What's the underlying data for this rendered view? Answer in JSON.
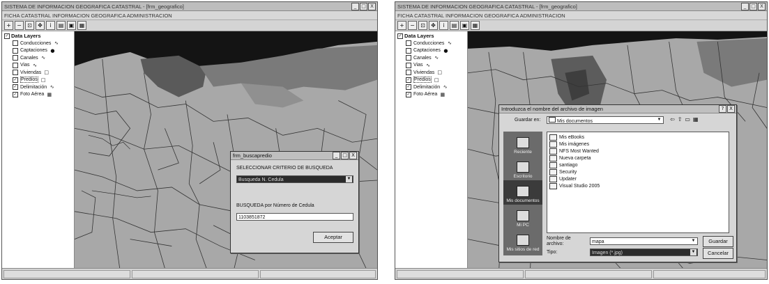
{
  "left": {
    "title": "SISTEMA DE INFORMACION GEOGRAFICA CATASTRAL - [frm_geografico]",
    "menu": "FICHA CATASTRAL   INFORMACION GEOGRAFICA   ADMINISTRACION",
    "window_buttons": [
      "_",
      "□",
      "X"
    ],
    "layers_title": "Data Layers",
    "layers": [
      {
        "label": "Conducciones",
        "checked": false,
        "symbol": "∿"
      },
      {
        "label": "Captaciones",
        "checked": false,
        "symbol": "●"
      },
      {
        "label": "Canales",
        "checked": false,
        "symbol": "∿"
      },
      {
        "label": "Vias",
        "checked": false,
        "symbol": "∿"
      },
      {
        "label": "Viviendas",
        "checked": false,
        "symbol": "□"
      },
      {
        "label": "Predios",
        "checked": true,
        "symbol": "□"
      },
      {
        "label": "Delimitación",
        "checked": true,
        "symbol": "∿"
      },
      {
        "label": "Foto Aérea",
        "checked": true,
        "symbol": "▦"
      }
    ],
    "dialog": {
      "title": "frm_buscapredio",
      "buttons": [
        "_",
        "□",
        "X"
      ],
      "criteria_label": "SELECCIONAR CRITERIO DE BUSQUEDA",
      "criteria_value": "Busqueda N. Cedula",
      "search_label": "BUSQUEDA por Número de Cedula",
      "search_value": "1103851872",
      "accept": "Aceptar"
    }
  },
  "right": {
    "title": "SISTEMA DE INFORMACION GEOGRAFICA CATASTRAL - [frm_geografico]",
    "menu": "FICHA CATASTRAL   INFORMACION GEOGRAFICA   ADMINISTRACION",
    "window_buttons": [
      "_",
      "□",
      "X"
    ],
    "layers_title": "Data Layers",
    "layers": [
      {
        "label": "Conducciones",
        "checked": false,
        "symbol": "∿"
      },
      {
        "label": "Captaciones",
        "checked": false,
        "symbol": "●"
      },
      {
        "label": "Canales",
        "checked": false,
        "symbol": "∿"
      },
      {
        "label": "Vias",
        "checked": false,
        "symbol": "∿"
      },
      {
        "label": "Viviendas",
        "checked": false,
        "symbol": "□"
      },
      {
        "label": "Predios",
        "checked": true,
        "symbol": "□"
      },
      {
        "label": "Delimitación",
        "checked": true,
        "symbol": "∿"
      },
      {
        "label": "Foto Aérea",
        "checked": true,
        "symbol": "▦"
      }
    ],
    "dialog": {
      "title": "Introduzca el nombre del archivo de imagen",
      "buttons": [
        "?",
        "X"
      ],
      "save_in_label": "Guardar en:",
      "save_in_value": "Mis documentos",
      "places": [
        "Reciente",
        "Escritorio",
        "Mis documentos",
        "Mi PC",
        "Mis sitios de red"
      ],
      "files": [
        "Mis eBooks",
        "Mis imágenes",
        "NFS Most Wanted",
        "Nueva carpeta",
        "santiago",
        "Security",
        "Updater",
        "Visual Studio 2005"
      ],
      "filename_label": "Nombre de archivo:",
      "filename_value": "mapa",
      "type_label": "Tipo:",
      "type_value": "Imagen (*.jpg)",
      "save": "Guardar",
      "cancel": "Cancelar"
    }
  }
}
